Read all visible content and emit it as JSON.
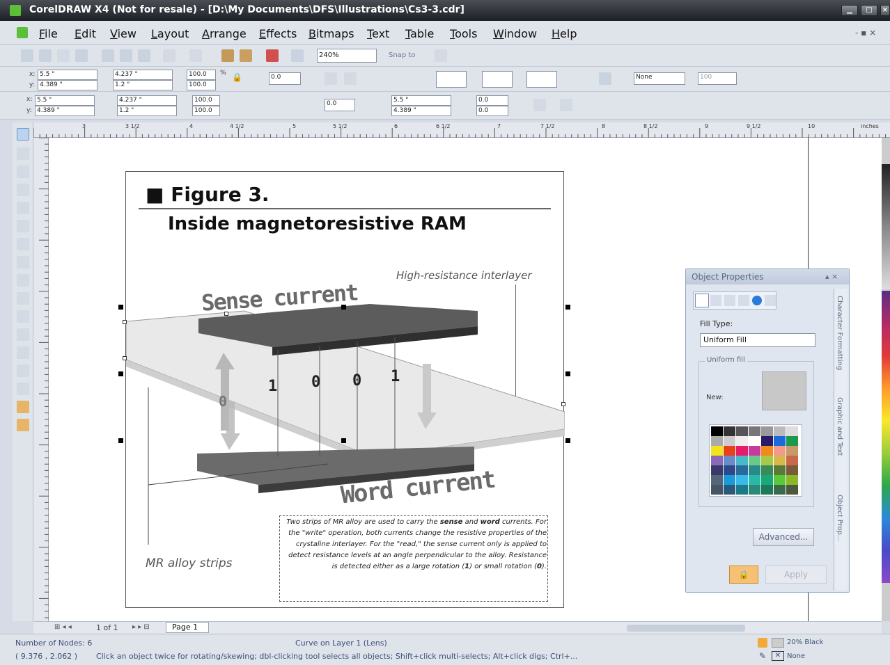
{
  "window": {
    "title": "CorelDRAW X4 (Not for resale) - [D:\\My Documents\\DFS\\Illustrations\\Cs3-3.cdr]"
  },
  "menu": [
    "File",
    "Edit",
    "View",
    "Layout",
    "Arrange",
    "Effects",
    "Bitmaps",
    "Text",
    "Table",
    "Tools",
    "Window",
    "Help"
  ],
  "toolbar": {
    "zoom": "240%",
    "snap": "Snap to"
  },
  "propbar1": {
    "x": "5.5 \"",
    "y": "4.389 \"",
    "w": "4.237 \"",
    "h": "1.2 \"",
    "sx": "100.0",
    "sy": "100.0",
    "pct": "%",
    "angle": "0.0",
    "outline": "None",
    "opacity": "100"
  },
  "propbar2": {
    "x": "5.5 \"",
    "y": "4.389 \"",
    "w": "4.237 \"",
    "h": "1.2 \"",
    "sx": "100.0",
    "sy": "100.0",
    "angle": "0.0",
    "cx": "5.5 \"",
    "cy": "4.389 \"",
    "skx": "0.0",
    "sky": "0.0"
  },
  "ruler": {
    "units": "inches",
    "ticks": [
      "3",
      "3 1/2",
      "4",
      "4 1/2",
      "5",
      "5 1/2",
      "6",
      "6 1/2",
      "7",
      "7 1/2",
      "8",
      "8 1/2",
      "9",
      "9 1/2",
      "10"
    ]
  },
  "figure": {
    "title": "■ Figure 3.",
    "subtitle": "Inside magnetoresistive RAM",
    "interlayer": "High-resistance interlayer",
    "sense": "Sense current",
    "word": "Word current",
    "strips": "MR alloy strips",
    "bits": [
      "1",
      "0",
      "0",
      "1",
      "0"
    ],
    "caption_html": "Two strips of MR alloy are used to carry the <b>sense</b> and <b>word</b> currents. For the \"write\" operation, both currents change the resistive properties of the crystaline interlayer. For the \"read,\" the sense current only is applied to detect resistance levels at an angle perpendicular to the alloy. Resistance is detected either as a large rotation (<b>1</b>) or small rotation (<b>0</b>)."
  },
  "panel": {
    "title": "Object Properties",
    "fill_type_label": "Fill Type:",
    "fill_type": "Uniform Fill",
    "uniform_fill": "Uniform fill",
    "new": "New:",
    "advanced": "Advanced...",
    "apply": "Apply",
    "side_tabs": [
      "Character Formatting",
      "Graphic and Text",
      "Object Prop..."
    ]
  },
  "pagenav": {
    "count": "1 of 1",
    "page": "Page 1"
  },
  "status": {
    "nodes": "Number of Nodes: 6",
    "layer": "Curve on Layer 1  (Lens)",
    "coords": "( 9.376 , 2.062 )",
    "hint": "Click an object twice for rotating/skewing; dbl-clicking tool selects all objects; Shift+click multi-selects; Alt+click digs; Ctrl+...",
    "fill": "20% Black",
    "outline": "None"
  },
  "colors": {
    "accent": "#4a8cd8",
    "sense_bar": "#5a5a5a",
    "panel_bg": "#dfe6ef"
  }
}
